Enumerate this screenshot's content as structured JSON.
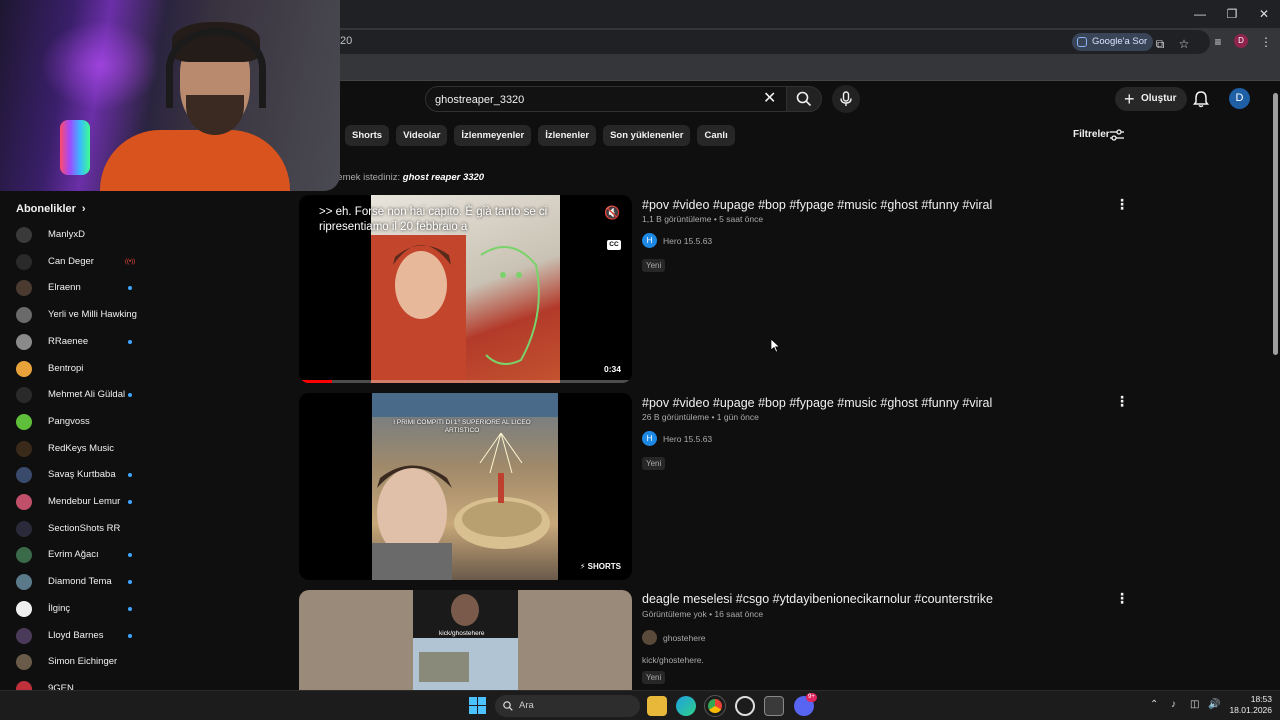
{
  "browser": {
    "url_fragment": "20",
    "ask_google": "Google'a Sor",
    "profile_initial": "D"
  },
  "header": {
    "search_value": "ghostreaper_3320",
    "create_label": "Oluştur",
    "avatar_initial": "D"
  },
  "chips": [
    "Shorts",
    "Videolar",
    "İzlenmeyenler",
    "İzlenenler",
    "Son yüklenenler",
    "Canlı"
  ],
  "filters_label": "Filtreler",
  "suggestion": {
    "prefix": "demek istediniz: ",
    "query": "ghost reaper 3320"
  },
  "sidebar": {
    "title": "Abonelikler",
    "items": [
      {
        "name": "ManlyxD",
        "color": "#3a3a3a",
        "indicator": "none"
      },
      {
        "name": "Can Deger",
        "color": "#2a2a2a",
        "indicator": "live"
      },
      {
        "name": "Elraenn",
        "color": "#4a3a30",
        "indicator": "dot"
      },
      {
        "name": "Yerli ve Milli Hawking",
        "color": "#6a6a6a",
        "indicator": "none"
      },
      {
        "name": "RRaenee",
        "color": "#8a8a8a",
        "indicator": "dot"
      },
      {
        "name": "Bentropi",
        "color": "#e8a23a",
        "indicator": "none"
      },
      {
        "name": "Mehmet Ali Güldal",
        "color": "#2a2a2a",
        "indicator": "dot"
      },
      {
        "name": "Pangvoss",
        "color": "#5fbf3a",
        "indicator": "none"
      },
      {
        "name": "RedKeys Music",
        "color": "#3a2a1a",
        "indicator": "none"
      },
      {
        "name": "Savaş Kurtbaba",
        "color": "#3a4a6a",
        "indicator": "dot"
      },
      {
        "name": "Mendebur Lemur",
        "color": "#c0506a",
        "indicator": "dot"
      },
      {
        "name": "SectionShots RR",
        "color": "#2a2a3a",
        "indicator": "none"
      },
      {
        "name": "Evrim Ağacı",
        "color": "#3a6a4a",
        "indicator": "dot"
      },
      {
        "name": "Diamond Tema",
        "color": "#5a7a8a",
        "indicator": "dot"
      },
      {
        "name": "İlginç",
        "color": "#f0f0f0",
        "indicator": "dot"
      },
      {
        "name": "Lloyd Barnes",
        "color": "#4a3a5a",
        "indicator": "dot"
      },
      {
        "name": "Simon Eichinger",
        "color": "#6a5a4a",
        "indicator": "none"
      },
      {
        "name": "9GEN",
        "color": "#c0303a",
        "indicator": "none"
      }
    ]
  },
  "results": [
    {
      "title": "#pov #video #upage #bop #fypage #music #ghost #funny #viral",
      "meta": "1,1 B görüntüleme • 5 saat önce",
      "channel": "Hero 15.5.63",
      "channel_initial": "H",
      "badge": "Yeni",
      "overlay_caption": ">> eh. Forse non hai capito. È già tanto se ci ripresentiamo il 20 febbraio a",
      "duration": "0:34",
      "progress": 0.1
    },
    {
      "title": "#pov #video #upage #bop #fypage #music #ghost #funny #viral",
      "meta": "26 B görüntüleme • 1 gün önce",
      "channel": "Hero 15.5.63",
      "channel_initial": "H",
      "badge": "Yeni",
      "thumb_text": "I PRIMI COMPITI DI 1° SUPERIORE AL LICEO ARTISTICO",
      "shorts_label": "SHORTS"
    },
    {
      "title": "deagle meselesi #csgo #ytdayibenionecikarnolur #counterstrike",
      "meta": "Görüntüleme yok • 16 saat önce",
      "channel": "ghostehere",
      "description": "kick/ghostehere.",
      "badge": "Yeni",
      "thumb_text": "kick/ghostehere"
    }
  ],
  "taskbar": {
    "search_placeholder": "Ara",
    "time": "18:53",
    "date": "18.01.2026",
    "discord_badge": "9+"
  }
}
